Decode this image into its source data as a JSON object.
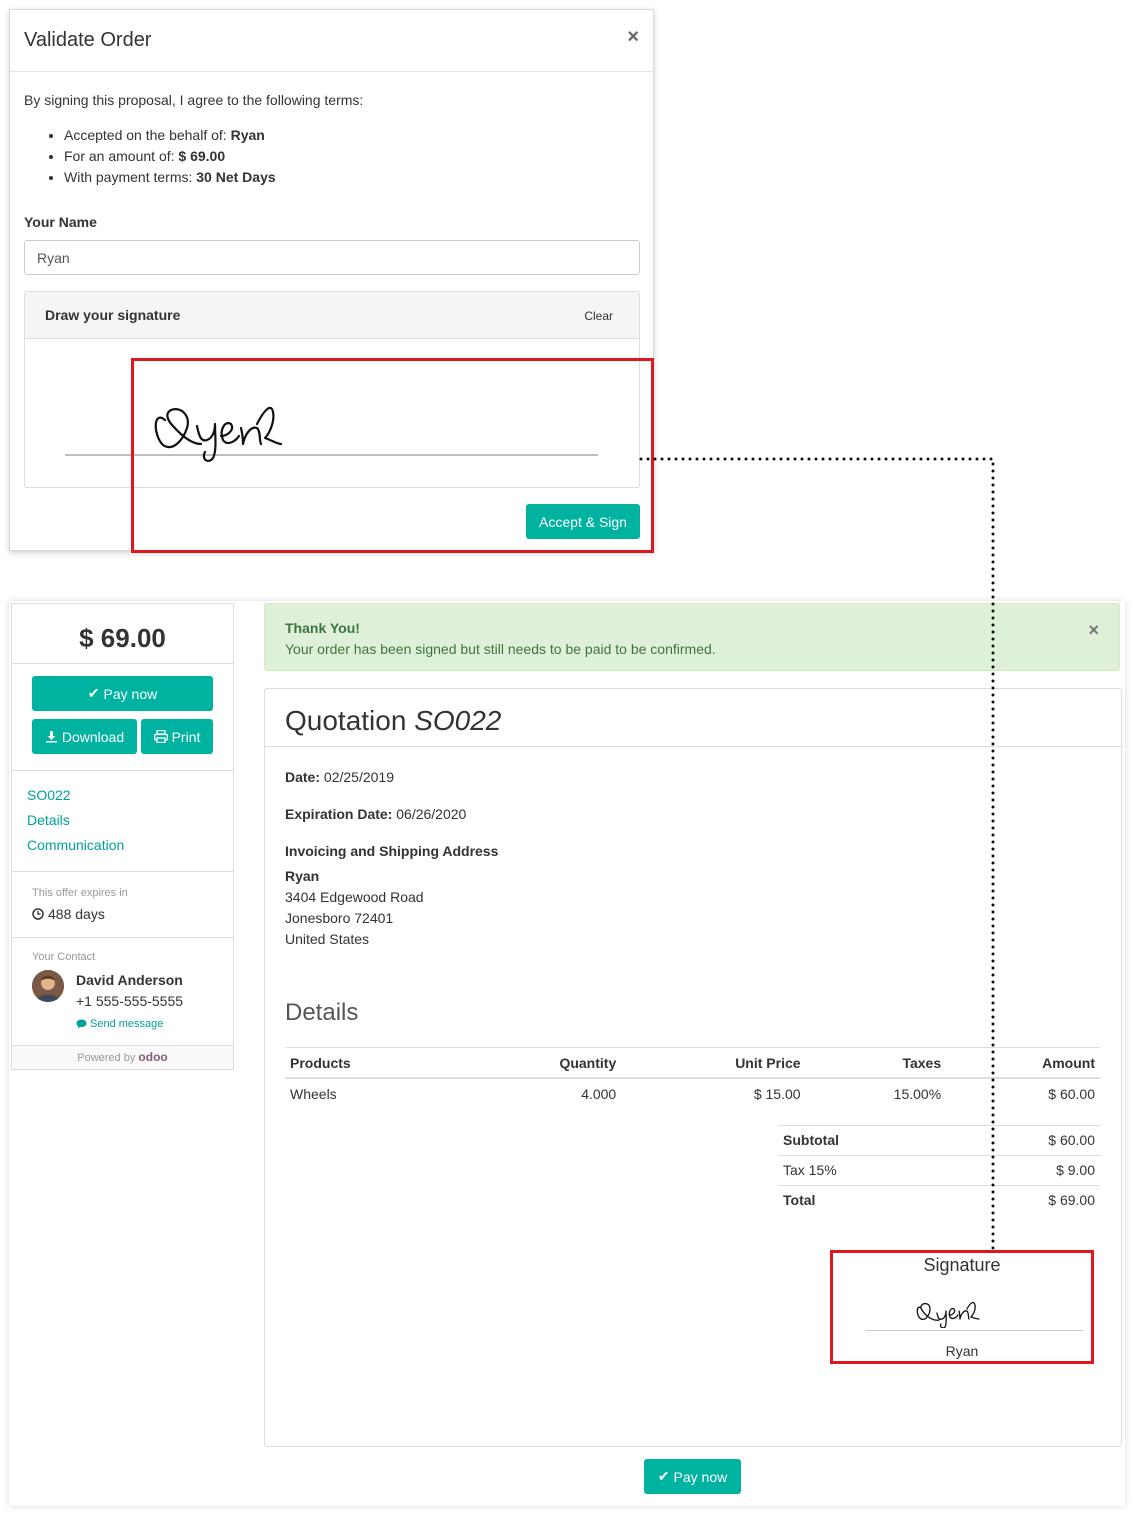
{
  "modal": {
    "title": "Validate Order",
    "close": "×",
    "intro": "By signing this proposal, I agree to the following terms:",
    "terms": [
      {
        "label": "Accepted on the behalf of: ",
        "value": "Ryan"
      },
      {
        "label": "For an amount of: ",
        "value": "$ 69.00"
      },
      {
        "label": "With payment terms: ",
        "value": "30 Net Days"
      }
    ],
    "name_label": "Your Name",
    "name_value": "Ryan",
    "signature_title": "Draw your signature",
    "clear_label": "Clear",
    "signature_text": "Ryan",
    "accept_label": "Accept & Sign"
  },
  "sidebar": {
    "total": "$ 69.00",
    "pay_now": "Pay now",
    "download": "Download",
    "print": "Print",
    "links": [
      "SO022",
      "Details",
      "Communication"
    ],
    "expires_label": "This offer expires in",
    "expires_value": "488 days",
    "contact_label": "Your Contact",
    "contact_name": "David Anderson",
    "contact_phone": "+1 555-555-5555",
    "send_message": "Send message",
    "powered_by": "Powered by",
    "powered_logo": "odoo"
  },
  "alert": {
    "title": "Thank You!",
    "message": "Your order has been signed but still needs to be paid to be confirmed.",
    "close": "×"
  },
  "document": {
    "title_prefix": "Quotation",
    "title_ref": "SO022",
    "date_label": "Date:",
    "date_value": "02/25/2019",
    "expiration_label": "Expiration Date:",
    "expiration_value": "06/26/2020",
    "address_label": "Invoicing and Shipping Address",
    "address_name": "Ryan",
    "address_lines": [
      "3404 Edgewood Road",
      "Jonesboro 72401",
      "United States"
    ],
    "details_title": "Details",
    "columns": [
      "Products",
      "Quantity",
      "Unit Price",
      "Taxes",
      "Amount"
    ],
    "rows": [
      {
        "product": "Wheels",
        "quantity": "4.000",
        "unit_price": "$ 15.00",
        "taxes": "15.00%",
        "amount": "$ 60.00"
      }
    ],
    "totals": [
      {
        "label": "Subtotal",
        "value": "$ 60.00"
      },
      {
        "label": "Tax 15%",
        "value": "$ 9.00"
      },
      {
        "label": "Total",
        "value": "$ 69.00"
      }
    ],
    "signature_title": "Signature",
    "signature_text": "Ryan",
    "signer_name": "Ryan"
  },
  "bottom": {
    "pay_now": "Pay now"
  },
  "colors": {
    "accent": "#00b3a1",
    "highlight": "#e0181e",
    "alert_bg": "#dff0d8"
  }
}
